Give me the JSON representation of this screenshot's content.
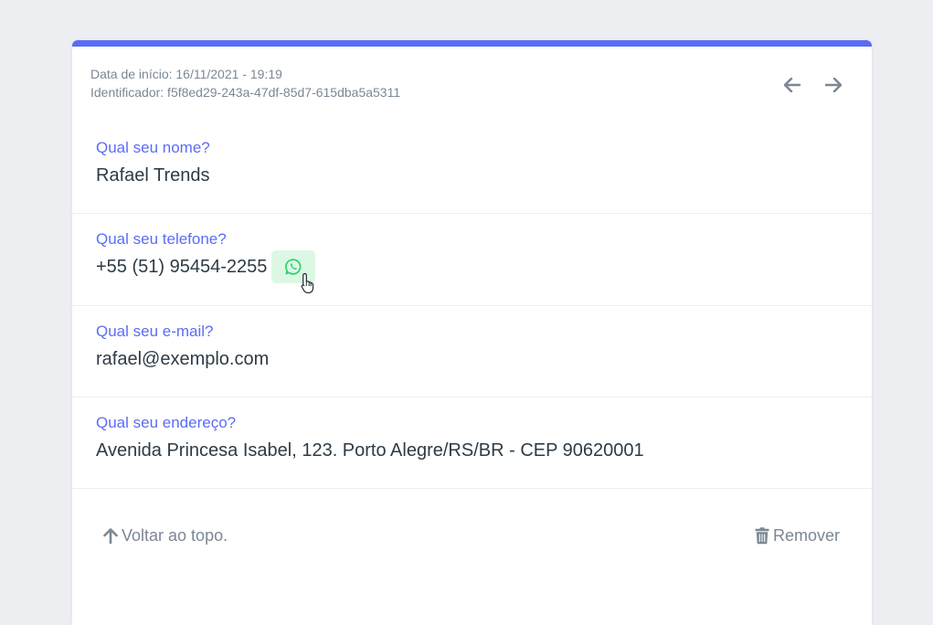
{
  "header": {
    "start_date": "Data de início: 16/11/2021 - 19:19",
    "identifier": "Identificador: f5f8ed29-243a-47df-85d7-615dba5a5311"
  },
  "fields": [
    {
      "label": "Qual seu nome?",
      "value": "Rafael Trends"
    },
    {
      "label": "Qual seu telefone?",
      "value": "+55 (51) 95454-2255"
    },
    {
      "label": "Qual seu e-mail?",
      "value": "rafael@exemplo.com"
    },
    {
      "label": "Qual seu endereço?",
      "value": "Avenida Princesa Isabel, 123. Porto Alegre/RS/BR - CEP 90620001"
    }
  ],
  "footer": {
    "back_to_top": "Voltar ao topo.",
    "remove": "Remover"
  },
  "icons": {
    "prev": "arrow-left-icon",
    "next": "arrow-right-icon",
    "whatsapp": "whatsapp-icon",
    "up": "arrow-up-icon",
    "trash": "trash-icon"
  },
  "colors": {
    "accent": "#5b6cf5",
    "whatsapp": "#25d366",
    "muted": "#7b8794"
  }
}
